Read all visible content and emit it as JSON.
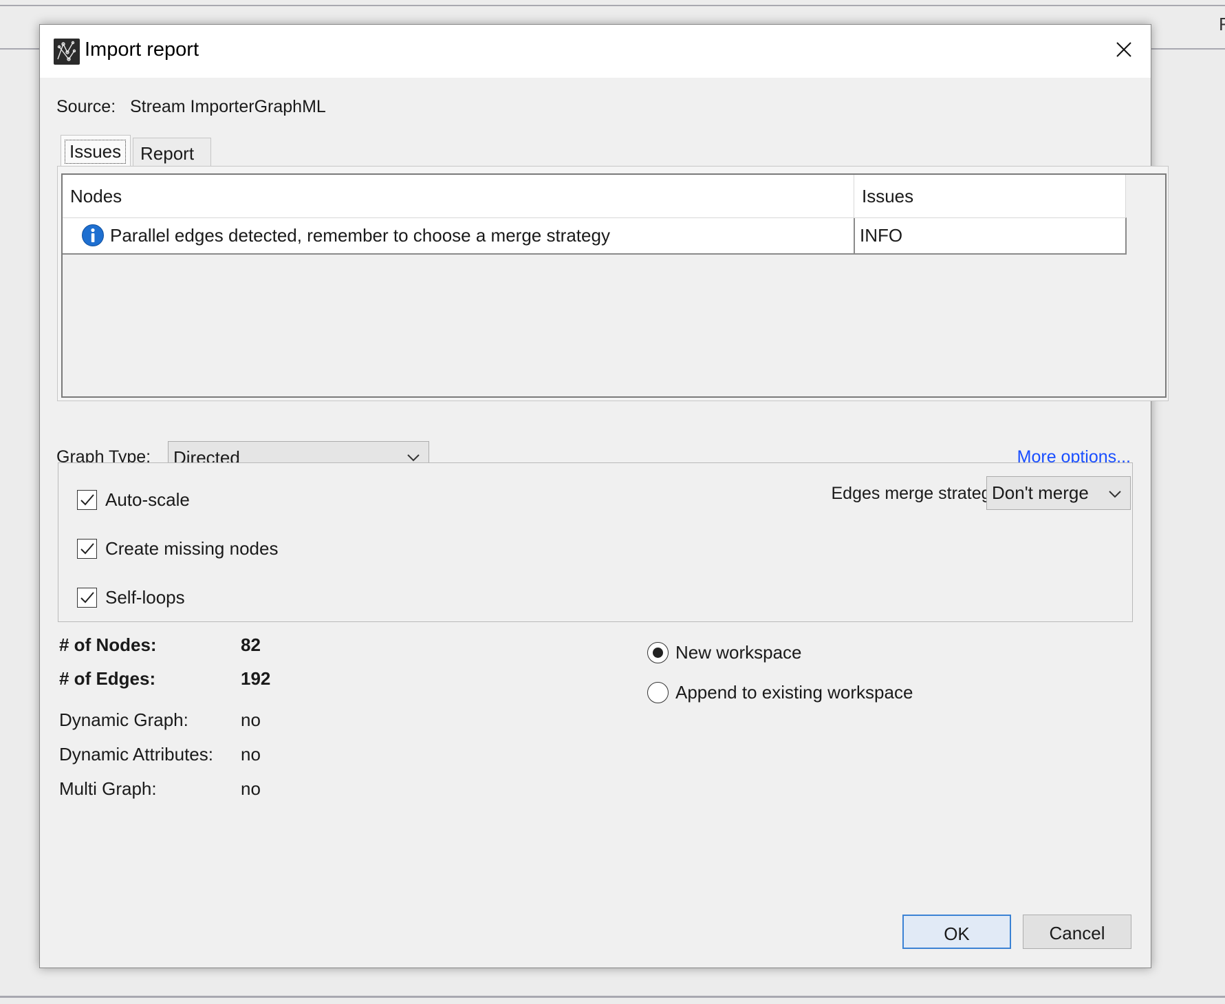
{
  "background": {
    "edge_letter": "F"
  },
  "dialog": {
    "title": "Import report",
    "close_icon": "close-icon",
    "source_label": "Source:",
    "source_value": "Stream ImporterGraphML",
    "tabs": [
      {
        "label": "Issues",
        "selected": true
      },
      {
        "label": "Report",
        "selected": false
      }
    ],
    "issues_table": {
      "columns": [
        "Nodes",
        "Issues"
      ],
      "rows": [
        {
          "icon": "info-icon",
          "message": "Parallel edges detected, remember to choose a merge strategy",
          "level": "INFO"
        }
      ]
    },
    "graph_type": {
      "label": "Graph Type:",
      "value": "Directed"
    },
    "more_options": "More options...",
    "checkboxes": [
      {
        "label": "Auto-scale",
        "checked": true
      },
      {
        "label": "Create missing nodes",
        "checked": true
      },
      {
        "label": "Self-loops",
        "checked": true
      }
    ],
    "edges_merge": {
      "label": "Edges merge strategy:",
      "value": "Don't merge"
    },
    "stats": [
      {
        "label": "# of Nodes:",
        "value": "82",
        "bold": true
      },
      {
        "label": "# of Edges:",
        "value": "192",
        "bold": true
      },
      {
        "label": "Dynamic Graph:",
        "value": "no",
        "bold": false
      },
      {
        "label": "Dynamic Attributes:",
        "value": "no",
        "bold": false
      },
      {
        "label": "Multi Graph:",
        "value": "no",
        "bold": false
      }
    ],
    "workspace_options": [
      {
        "label": "New workspace",
        "selected": true
      },
      {
        "label": "Append to existing workspace",
        "selected": false
      }
    ],
    "buttons": {
      "ok": "OK",
      "cancel": "Cancel"
    },
    "colors": {
      "link": "#1a4fff",
      "ok_border": "#3b82d4",
      "info_icon": "#1e6fd0"
    }
  }
}
